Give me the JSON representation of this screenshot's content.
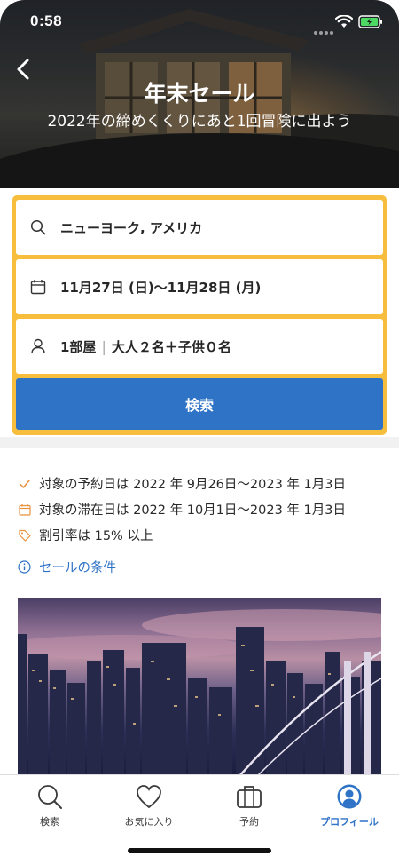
{
  "status_bar": {
    "time": "0:58"
  },
  "hero": {
    "title": "年末セール",
    "subtitle": "2022年の締めくくりにあと1回冒険に出よう"
  },
  "search": {
    "destination": "ニューヨーク, アメリカ",
    "dates": "11月27日 (日)〜11月28日 (月)",
    "rooms": "1部屋",
    "guests": "大人２名＋子供０名",
    "button_label": "検索"
  },
  "conditions": {
    "items": [
      {
        "icon": "check-icon",
        "text": "対象の予約日は 2022 年 9月26日〜2023 年 1月3日"
      },
      {
        "icon": "calendar-icon",
        "text": "対象の滞在日は 2022 年 10月1日〜2023 年 1月3日"
      },
      {
        "icon": "tag-icon",
        "text": "割引率は 15% 以上"
      }
    ],
    "link_label": "セールの条件"
  },
  "tab_bar": {
    "tabs": [
      {
        "label": "検索",
        "icon": "search-icon"
      },
      {
        "label": "お気に入り",
        "icon": "heart-icon"
      },
      {
        "label": "予約",
        "icon": "briefcase-icon"
      },
      {
        "label": "プロフィール",
        "icon": "profile-icon",
        "active": true
      }
    ]
  },
  "colors": {
    "accent_yellow": "#f6be3c",
    "primary_blue": "#2f73c6",
    "condition_icon_orange": "#e8913c"
  }
}
